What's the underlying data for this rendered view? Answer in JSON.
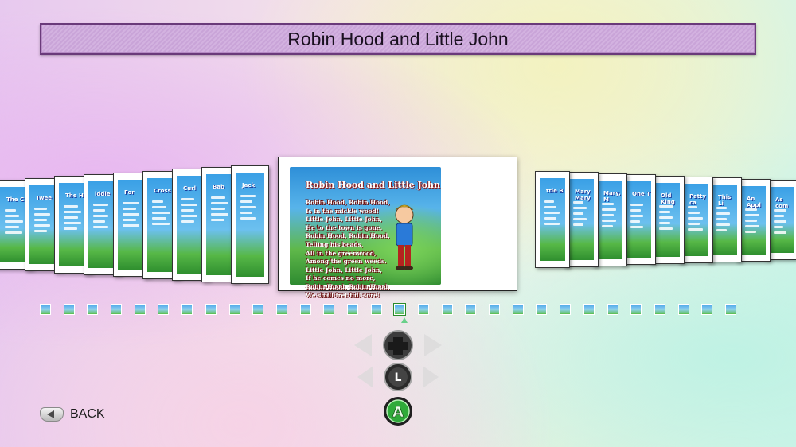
{
  "title": "Robin Hood and Little John",
  "featured_card": {
    "title": "Robin Hood and Little John",
    "poem_lines": [
      "Robin Hood, Robin Hood,",
      "Is in the mickle wood!",
      "Little John, Little John,",
      "He to the town is gone.",
      "Robin Hood, Robin Hood,",
      "Telling his beads,",
      "All in the greenwood,",
      "Among the green weeds.",
      "Little John, Little John,",
      "If he comes no more,",
      "Robin Hood, Robin Hood,",
      "We shall fret full sore!"
    ]
  },
  "left_cards": [
    {
      "title": "The C"
    },
    {
      "title": "Twee"
    },
    {
      "title": "The H"
    },
    {
      "title": "iddle"
    },
    {
      "title": "For"
    },
    {
      "title": "Cross"
    },
    {
      "title": "Curl"
    },
    {
      "title": "Bab"
    },
    {
      "title": "Jack"
    }
  ],
  "right_cards": [
    {
      "title": "ttle B"
    },
    {
      "title": "Mary Mary"
    },
    {
      "title": "Mary, M"
    },
    {
      "title": "One T"
    },
    {
      "title": "Old King"
    },
    {
      "title": "Patty ca"
    },
    {
      "title": "This Li"
    },
    {
      "title": "An Appl"
    },
    {
      "title": "As com"
    }
  ],
  "thumbnail_count": 30,
  "selected_thumbnail_index": 15,
  "controls": {
    "dpad_icon": "dpad-icon",
    "stick_label": "L",
    "a_label": "A"
  },
  "back": {
    "label": "BACK",
    "icon": "back-button-icon"
  },
  "colors": {
    "title_bar": "#cfa9dc",
    "title_border": "#6a3a7a",
    "a_button": "#2faa3a"
  }
}
